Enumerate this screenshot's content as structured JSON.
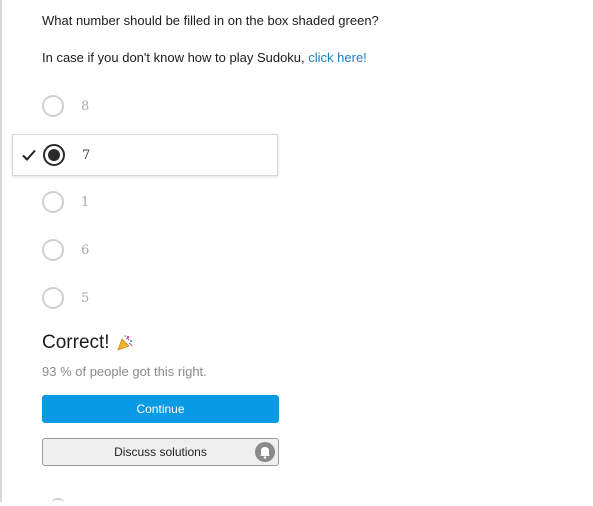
{
  "question": {
    "text": "What number should be filled in on the box shaded green?",
    "hint_prefix": "In case if you don't know how to play Sudoku, ",
    "hint_link": "click here!"
  },
  "choices": [
    {
      "label": "8",
      "selected": false
    },
    {
      "label": "7",
      "selected": true
    },
    {
      "label": "1",
      "selected": false
    },
    {
      "label": "6",
      "selected": false
    },
    {
      "label": "5",
      "selected": false
    }
  ],
  "result": {
    "title": "Correct!",
    "icon": "party-popper-icon",
    "stat": "93 % of people got this right."
  },
  "buttons": {
    "continue_label": "Continue",
    "discuss_label": "Discuss solutions"
  },
  "colors": {
    "accent": "#0a99e3",
    "link": "#1a7fc1"
  }
}
